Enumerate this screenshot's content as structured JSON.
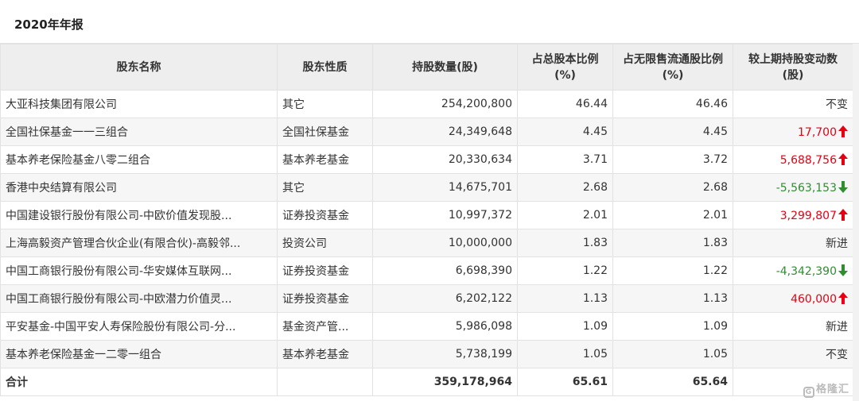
{
  "title": "2020年年报",
  "headers": {
    "name": "股东名称",
    "nature": "股东性质",
    "shares": "持股数量(股)",
    "ratio_total": "占总股本比例(%)",
    "ratio_float": "占无限售流通股比例(%)",
    "change": "较上期持股变动数(股)"
  },
  "rows": [
    {
      "name": "大亚科技集团有限公司",
      "nature": "其它",
      "shares": "254,200,800",
      "ratio_total": "46.44",
      "ratio_float": "46.46",
      "change": "不变",
      "direction": "none"
    },
    {
      "name": "全国社保基金一一三组合",
      "nature": "全国社保基金",
      "shares": "24,349,648",
      "ratio_total": "4.45",
      "ratio_float": "4.45",
      "change": "17,700",
      "direction": "up"
    },
    {
      "name": "基本养老保险基金八零二组合",
      "nature": "基本养老基金",
      "shares": "20,330,634",
      "ratio_total": "3.71",
      "ratio_float": "3.72",
      "change": "5,688,756",
      "direction": "up"
    },
    {
      "name": "香港中央结算有限公司",
      "nature": "其它",
      "shares": "14,675,701",
      "ratio_total": "2.68",
      "ratio_float": "2.68",
      "change": "-5,563,153",
      "direction": "down"
    },
    {
      "name": "中国建设银行股份有限公司-中欧价值发现股...",
      "nature": "证券投资基金",
      "shares": "10,997,372",
      "ratio_total": "2.01",
      "ratio_float": "2.01",
      "change": "3,299,807",
      "direction": "up"
    },
    {
      "name": "上海高毅资产管理合伙企业(有限合伙)-高毅邻...",
      "nature": "投资公司",
      "shares": "10,000,000",
      "ratio_total": "1.83",
      "ratio_float": "1.83",
      "change": "新进",
      "direction": "none"
    },
    {
      "name": "中国工商银行股份有限公司-华安媒体互联网...",
      "nature": "证券投资基金",
      "shares": "6,698,390",
      "ratio_total": "1.22",
      "ratio_float": "1.22",
      "change": "-4,342,390",
      "direction": "down"
    },
    {
      "name": "中国工商银行股份有限公司-中欧潜力价值灵...",
      "nature": "证券投资基金",
      "shares": "6,202,122",
      "ratio_total": "1.13",
      "ratio_float": "1.13",
      "change": "460,000",
      "direction": "up"
    },
    {
      "name": "平安基金-中国平安人寿保险股份有限公司-分...",
      "nature": "基金资产管...",
      "shares": "5,986,098",
      "ratio_total": "1.09",
      "ratio_float": "1.09",
      "change": "新进",
      "direction": "none"
    },
    {
      "name": "基本养老保险基金一二零一组合",
      "nature": "基本养老基金",
      "shares": "5,738,199",
      "ratio_total": "1.05",
      "ratio_float": "1.05",
      "change": "不变",
      "direction": "none"
    }
  ],
  "total": {
    "label": "合计",
    "nature": "",
    "shares": "359,178,964",
    "ratio_total": "65.61",
    "ratio_float": "65.64",
    "change": ""
  },
  "watermark": "格隆汇",
  "colors": {
    "up": "#e60012",
    "down": "#2f8f2f",
    "header_bg": "#eeeeee",
    "stripe_bg": "#f6f6f6"
  }
}
